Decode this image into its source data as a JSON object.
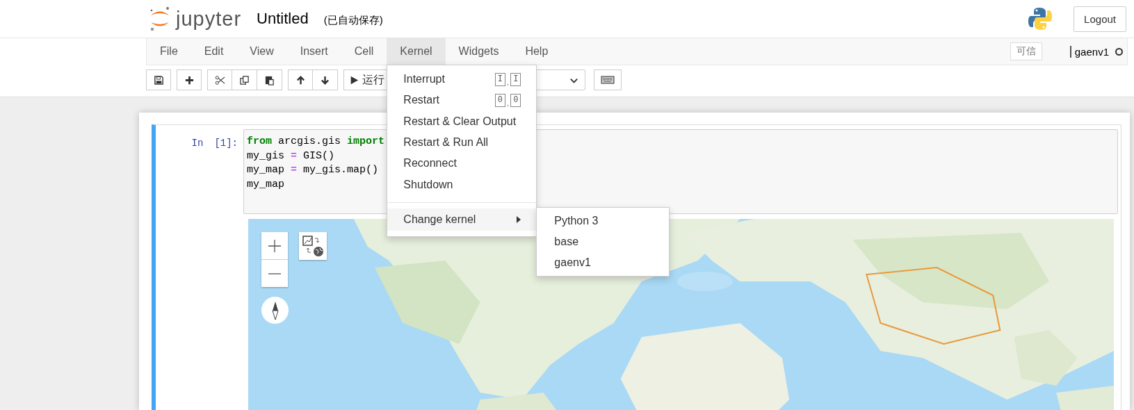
{
  "header": {
    "logo_text": "jupyter",
    "title": "Untitled",
    "autosave": "(已自动保存)",
    "logout": "Logout"
  },
  "menubar": {
    "items": [
      {
        "label": "File",
        "selected": false
      },
      {
        "label": "Edit",
        "selected": false
      },
      {
        "label": "View",
        "selected": false
      },
      {
        "label": "Insert",
        "selected": false
      },
      {
        "label": "Cell",
        "selected": false
      },
      {
        "label": "Kernel",
        "selected": true
      },
      {
        "label": "Widgets",
        "selected": false
      },
      {
        "label": "Help",
        "selected": false
      }
    ],
    "trusted": "可信",
    "kernel_name": "gaenv1",
    "kernel_busy": false
  },
  "toolbar": {
    "run_label": "运行"
  },
  "kernel_menu": {
    "items": [
      {
        "kind": "item",
        "label": "Interrupt",
        "shortcut": {
          "keys": [
            "I",
            "I"
          ],
          "separator": ","
        }
      },
      {
        "kind": "item",
        "label": "Restart",
        "shortcut": {
          "keys": [
            "0",
            "0"
          ],
          "separator": ","
        }
      },
      {
        "kind": "item",
        "label": "Restart & Clear Output"
      },
      {
        "kind": "item",
        "label": "Restart & Run All"
      },
      {
        "kind": "item",
        "label": "Reconnect"
      },
      {
        "kind": "item",
        "label": "Shutdown"
      },
      {
        "kind": "divider"
      },
      {
        "kind": "submenu",
        "label": "Change kernel",
        "expanded": true,
        "children": [
          {
            "label": "Python 3"
          },
          {
            "label": "base"
          },
          {
            "label": "gaenv1"
          }
        ]
      }
    ]
  },
  "cell": {
    "prompt": "In",
    "count": "[1]:",
    "selected": true,
    "lines": [
      [
        {
          "kind": "keyword",
          "text": "from"
        },
        {
          "kind": "plain",
          "text": " arcgis.gis "
        },
        {
          "kind": "keyword",
          "text": "import"
        }
      ],
      [
        {
          "kind": "plain",
          "text": "my_gis "
        },
        {
          "kind": "operator",
          "text": "="
        },
        {
          "kind": "plain",
          "text": " GIS()"
        }
      ],
      [
        {
          "kind": "plain",
          "text": "my_map "
        },
        {
          "kind": "operator",
          "text": "="
        },
        {
          "kind": "plain",
          "text": " my_gis.map()"
        }
      ],
      [
        {
          "kind": "plain",
          "text": "my_map"
        }
      ]
    ],
    "output": {
      "kind": "picture"
    }
  }
}
